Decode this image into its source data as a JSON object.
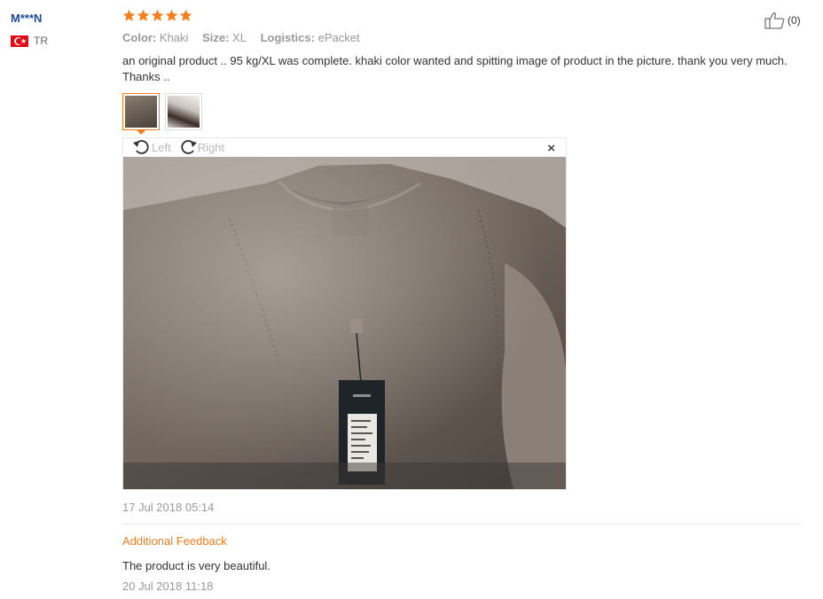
{
  "reviewer": {
    "name": "M***N",
    "country": "TR"
  },
  "rating": {
    "stars": 5,
    "max": 5,
    "color": "#f57e20"
  },
  "helpful": {
    "count": "(0)"
  },
  "attributes": [
    {
      "label": "Color:",
      "value": "Khaki"
    },
    {
      "label": "Size:",
      "value": "XL"
    },
    {
      "label": "Logistics:",
      "value": "ePacket"
    }
  ],
  "review": {
    "text": "an original product .. 95 kg/XL was complete. khaki color wanted and spitting image of product in the picture. thank you very much. Thanks ..",
    "date": "17 Jul 2018 05:14"
  },
  "viewer": {
    "rotate_left_label": "Left",
    "rotate_right_label": "Right",
    "close_glyph": "×"
  },
  "additional_feedback": {
    "heading": "Additional Feedback",
    "text": "The product is very beautiful.",
    "date": "20 Jul 2018 11:18"
  },
  "colors": {
    "accent": "#f57e20",
    "username": "#1a4e9c",
    "muted": "#999999"
  }
}
